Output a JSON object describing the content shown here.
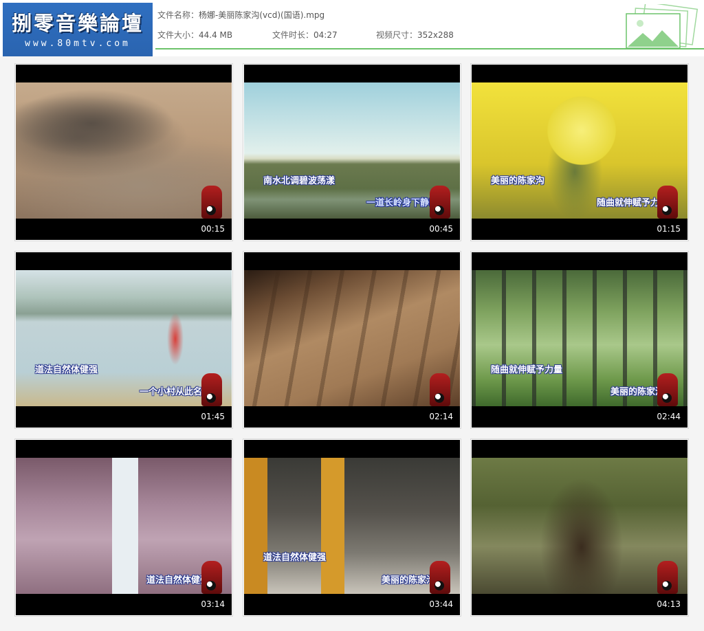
{
  "logo": {
    "title": "捌零音樂論壇",
    "url": "www.80mtv.com"
  },
  "file": {
    "name_label": "文件名称：",
    "name": "杨娜-美丽陈家沟(vcd)(国语).mpg",
    "size_label": "文件大小：",
    "size": "44.4 MB",
    "duration_label": "文件时长：",
    "duration": "04:27",
    "resolution_label": "视频尺寸：",
    "resolution": "352x288"
  },
  "thumbnails": [
    {
      "time": "00:15",
      "lyric1": "",
      "lyric2": ""
    },
    {
      "time": "00:45",
      "lyric1": "南水北调碧波荡漾",
      "lyric2": "一道长岭身下静卧"
    },
    {
      "time": "01:15",
      "lyric1": "美丽的陈家沟",
      "lyric2": "随曲就伸赋予力量"
    },
    {
      "time": "01:45",
      "lyric1": "道法自然体健强",
      "lyric2": "一个小村从此名扬"
    },
    {
      "time": "02:14",
      "lyric1": "",
      "lyric2": ""
    },
    {
      "time": "02:44",
      "lyric1": "随曲就伸赋予力量",
      "lyric2": "美丽的陈家沟"
    },
    {
      "time": "03:14",
      "lyric1": "",
      "lyric2": "道法自然体健强"
    },
    {
      "time": "03:44",
      "lyric1": "道法自然体健强",
      "lyric2": "美丽的陈家沟"
    },
    {
      "time": "04:13",
      "lyric1": "",
      "lyric2": ""
    }
  ]
}
